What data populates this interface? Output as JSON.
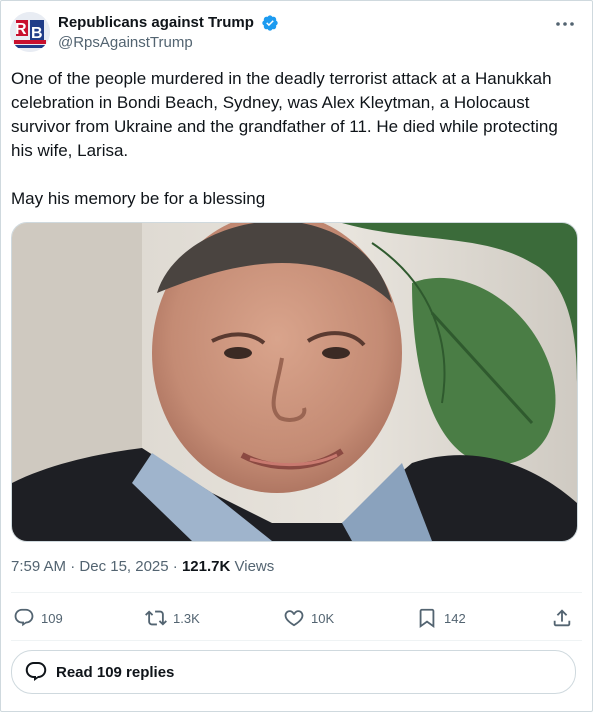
{
  "author": {
    "display_name": "Republicans against Trump",
    "handle": "@RpsAgainstTrump",
    "avatar_letters": "RB"
  },
  "tweet": {
    "text": "One of the people murdered in the deadly terrorist attack at a Hanukkah celebration in Bondi Beach, Sydney, was Alex Kleytman, a Holocaust survivor from Ukraine and the grandfather of 11. He died while protecting his wife, Larisa.\n\nMay his memory be for a blessing",
    "time": "7:59 AM",
    "separator": "·",
    "date": "Dec 15, 2025",
    "views_count": "121.7K",
    "views_label": "Views"
  },
  "actions": {
    "replies": "109",
    "reposts": "1.3K",
    "likes": "10K",
    "bookmarks": "142"
  },
  "read_replies_label": "Read 109 replies",
  "colors": {
    "verified": "#1d9bf0",
    "muted": "#536471",
    "border": "#cfd9de"
  },
  "icons": {
    "verified": "verified-badge-icon",
    "more": "more-options-icon",
    "reply": "reply-icon",
    "repost": "repost-icon",
    "like": "heart-icon",
    "bookmark": "bookmark-icon",
    "share": "share-icon",
    "replies_bubble": "speech-bubble-icon"
  }
}
